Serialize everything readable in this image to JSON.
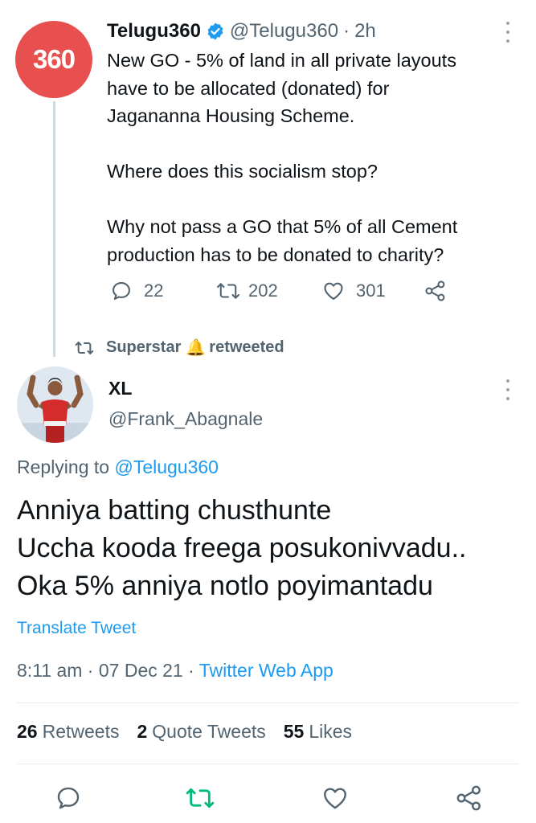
{
  "parent": {
    "avatar_text": "360",
    "name": "Telugu360",
    "handle": "@Telugu360",
    "separator": "·",
    "time": "2h",
    "text": "New GO - 5% of land in all private layouts\nhave to be allocated (donated) for\nJagananna Housing Scheme.\n\nWhere does this socialism stop?\n\nWhy not pass a GO that 5% of all Cement\nproduction has to be donated to charity?",
    "replies": "22",
    "retweets": "202",
    "likes": "301"
  },
  "retweet_context": {
    "user": "Superstar",
    "emoji": "🔔",
    "action": "retweeted"
  },
  "tweet": {
    "name": "XL",
    "handle": "@Frank_Abagnale",
    "replying_prefix": "Replying to",
    "replying_to": "@Telugu360",
    "text": "Anniya batting chusthunte\nUccha kooda freega posukonivvadu..\nOka 5% anniya notlo poyimantadu",
    "translate_label": "Translate Tweet",
    "time": "8:11 am",
    "dot": "·",
    "date": "07 Dec 21",
    "app": "Twitter Web App"
  },
  "stats": {
    "retweets_count": "26",
    "retweets_label": "Retweets",
    "quotes_count": "2",
    "quotes_label": "Quote Tweets",
    "likes_count": "55",
    "likes_label": "Likes"
  },
  "colors": {
    "accent": "#1d9bf0",
    "retweet_green": "#00ba7c",
    "muted": "#536471",
    "avatar_red": "#e84f4f"
  },
  "icons": {
    "reply": "reply-icon",
    "retweet": "retweet-icon",
    "like": "heart-icon",
    "share": "share-icon",
    "verified": "verified-badge-icon",
    "more": "more-options-icon"
  }
}
